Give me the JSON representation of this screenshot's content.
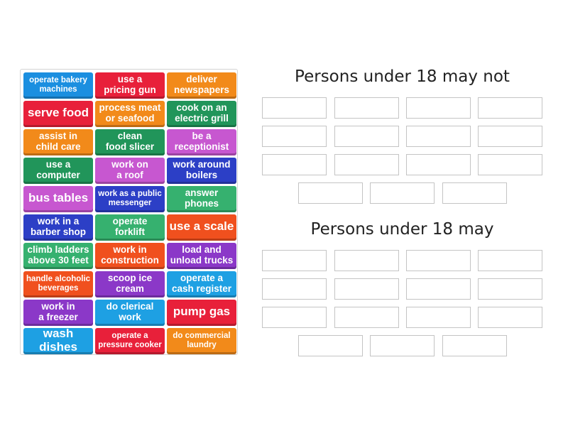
{
  "colors": {
    "blue": "#1b8fe0",
    "red": "#e8203a",
    "orange": "#f28a1a",
    "green": "#21955a",
    "purple": "#c757d0",
    "navy": "#2c3fc6",
    "teal": "#36b16f",
    "vermilion": "#f0501e",
    "violet": "#8b38c8",
    "cyan": "#1ea0e3"
  },
  "tiles": [
    {
      "label": "operate bakery\nmachines",
      "color": "blue",
      "size": "sm"
    },
    {
      "label": "use a\npricing gun",
      "color": "red",
      "size": "med"
    },
    {
      "label": "deliver\nnewspapers",
      "color": "orange",
      "size": "med"
    },
    {
      "label": "serve food",
      "color": "red",
      "size": "big"
    },
    {
      "label": "process meat\nor seafood",
      "color": "orange",
      "size": "med"
    },
    {
      "label": "cook on an\nelectric grill",
      "color": "green",
      "size": "med"
    },
    {
      "label": "assist in\nchild care",
      "color": "orange",
      "size": "med"
    },
    {
      "label": "clean\nfood slicer",
      "color": "green",
      "size": "med"
    },
    {
      "label": "be a\nreceptionist",
      "color": "purple",
      "size": "med"
    },
    {
      "label": "use a\ncomputer",
      "color": "green",
      "size": "med"
    },
    {
      "label": "work on\na roof",
      "color": "purple",
      "size": "med"
    },
    {
      "label": "work around\nboilers",
      "color": "navy",
      "size": "med"
    },
    {
      "label": "bus tables",
      "color": "purple",
      "size": "big"
    },
    {
      "label": "work as a public\nmessenger",
      "color": "navy",
      "size": "sm"
    },
    {
      "label": "answer\nphones",
      "color": "teal",
      "size": "med"
    },
    {
      "label": "work in a\nbarber shop",
      "color": "navy",
      "size": "med"
    },
    {
      "label": "operate\nforklift",
      "color": "teal",
      "size": "med"
    },
    {
      "label": "use a scale",
      "color": "vermilion",
      "size": "big"
    },
    {
      "label": "climb ladders\nabove 30 feet",
      "color": "teal",
      "size": "med"
    },
    {
      "label": "work in\nconstruction",
      "color": "vermilion",
      "size": "med"
    },
    {
      "label": "load and\nunload trucks",
      "color": "violet",
      "size": "med"
    },
    {
      "label": "handle alcoholic\nbeverages",
      "color": "vermilion",
      "size": "sm"
    },
    {
      "label": "scoop ice\ncream",
      "color": "violet",
      "size": "med"
    },
    {
      "label": "operate a\ncash register",
      "color": "cyan",
      "size": "med"
    },
    {
      "label": "work in\na freezer",
      "color": "violet",
      "size": "med"
    },
    {
      "label": "do clerical\nwork",
      "color": "cyan",
      "size": "med"
    },
    {
      "label": "pump gas",
      "color": "red",
      "size": "big"
    },
    {
      "label": "wash dishes",
      "color": "cyan",
      "size": "big"
    },
    {
      "label": "operate a\npressure cooker",
      "color": "red",
      "size": "sm"
    },
    {
      "label": "do commercial\nlaundry",
      "color": "orange",
      "size": "sm"
    }
  ],
  "groups": [
    {
      "title": "Persons under 18 may not",
      "slot_count": 15
    },
    {
      "title": "Persons under 18 may",
      "slot_count": 15
    }
  ]
}
